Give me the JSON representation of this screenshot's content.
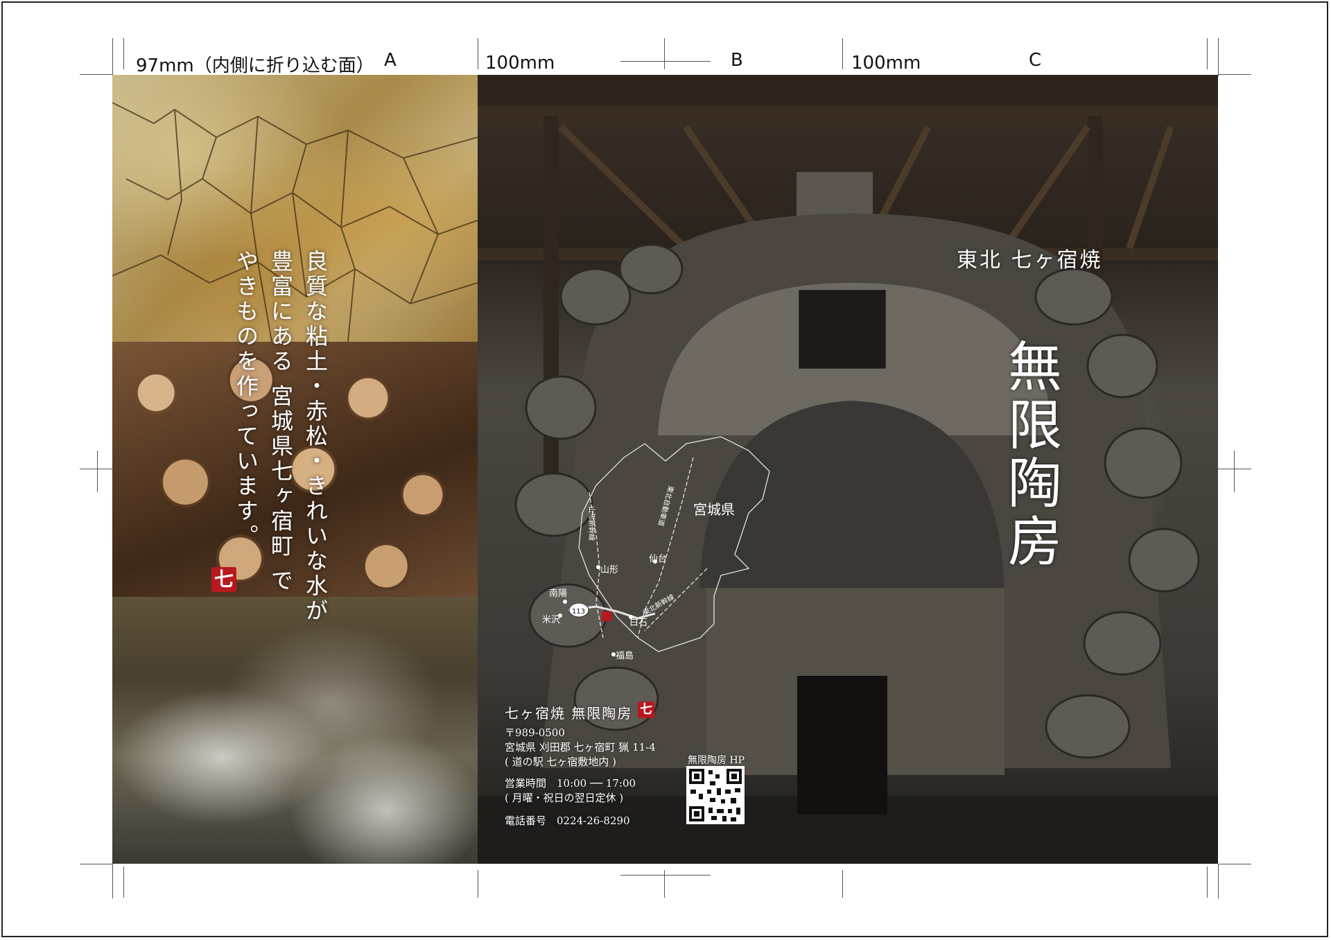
{
  "dimensions": {
    "panel_a": "97mm（内側に折り込む面）",
    "panel_a_letter": "A",
    "panel_b": "100mm",
    "panel_b_letter": "B",
    "panel_c": "100mm",
    "panel_c_letter": "C"
  },
  "tagline": {
    "line1": "良質な粘土・赤松・きれいな水が",
    "line2": "豊富にある 宮城県七ヶ宿町 で",
    "line3": "やきものを作っています。"
  },
  "logo_char": "七",
  "cover": {
    "subtitle": "東北 七ヶ宿焼",
    "title": "無限陶房"
  },
  "map": {
    "prefecture": "宮城県",
    "cities": [
      "山形",
      "仙台",
      "南陽",
      "米沢",
      "白石",
      "福島"
    ],
    "routes": [
      "山形新幹線",
      "東北自動車道",
      "東北新幹線"
    ],
    "road_number": "113"
  },
  "info": {
    "shop_name": "七ヶ宿焼 無限陶房",
    "postal": "〒989-0500",
    "address": "宮城県 刈田郡 七ヶ宿町 猟 11-4",
    "address_note": "( 道の駅 七ヶ宿敷地内 )",
    "hours": "営業時間　10:00 ── 17:00",
    "closed": "( 月曜・祝日の翌日定休 )",
    "phone": "電話番号　0224-26-8290",
    "qr_label": "無限陶房 HP"
  }
}
